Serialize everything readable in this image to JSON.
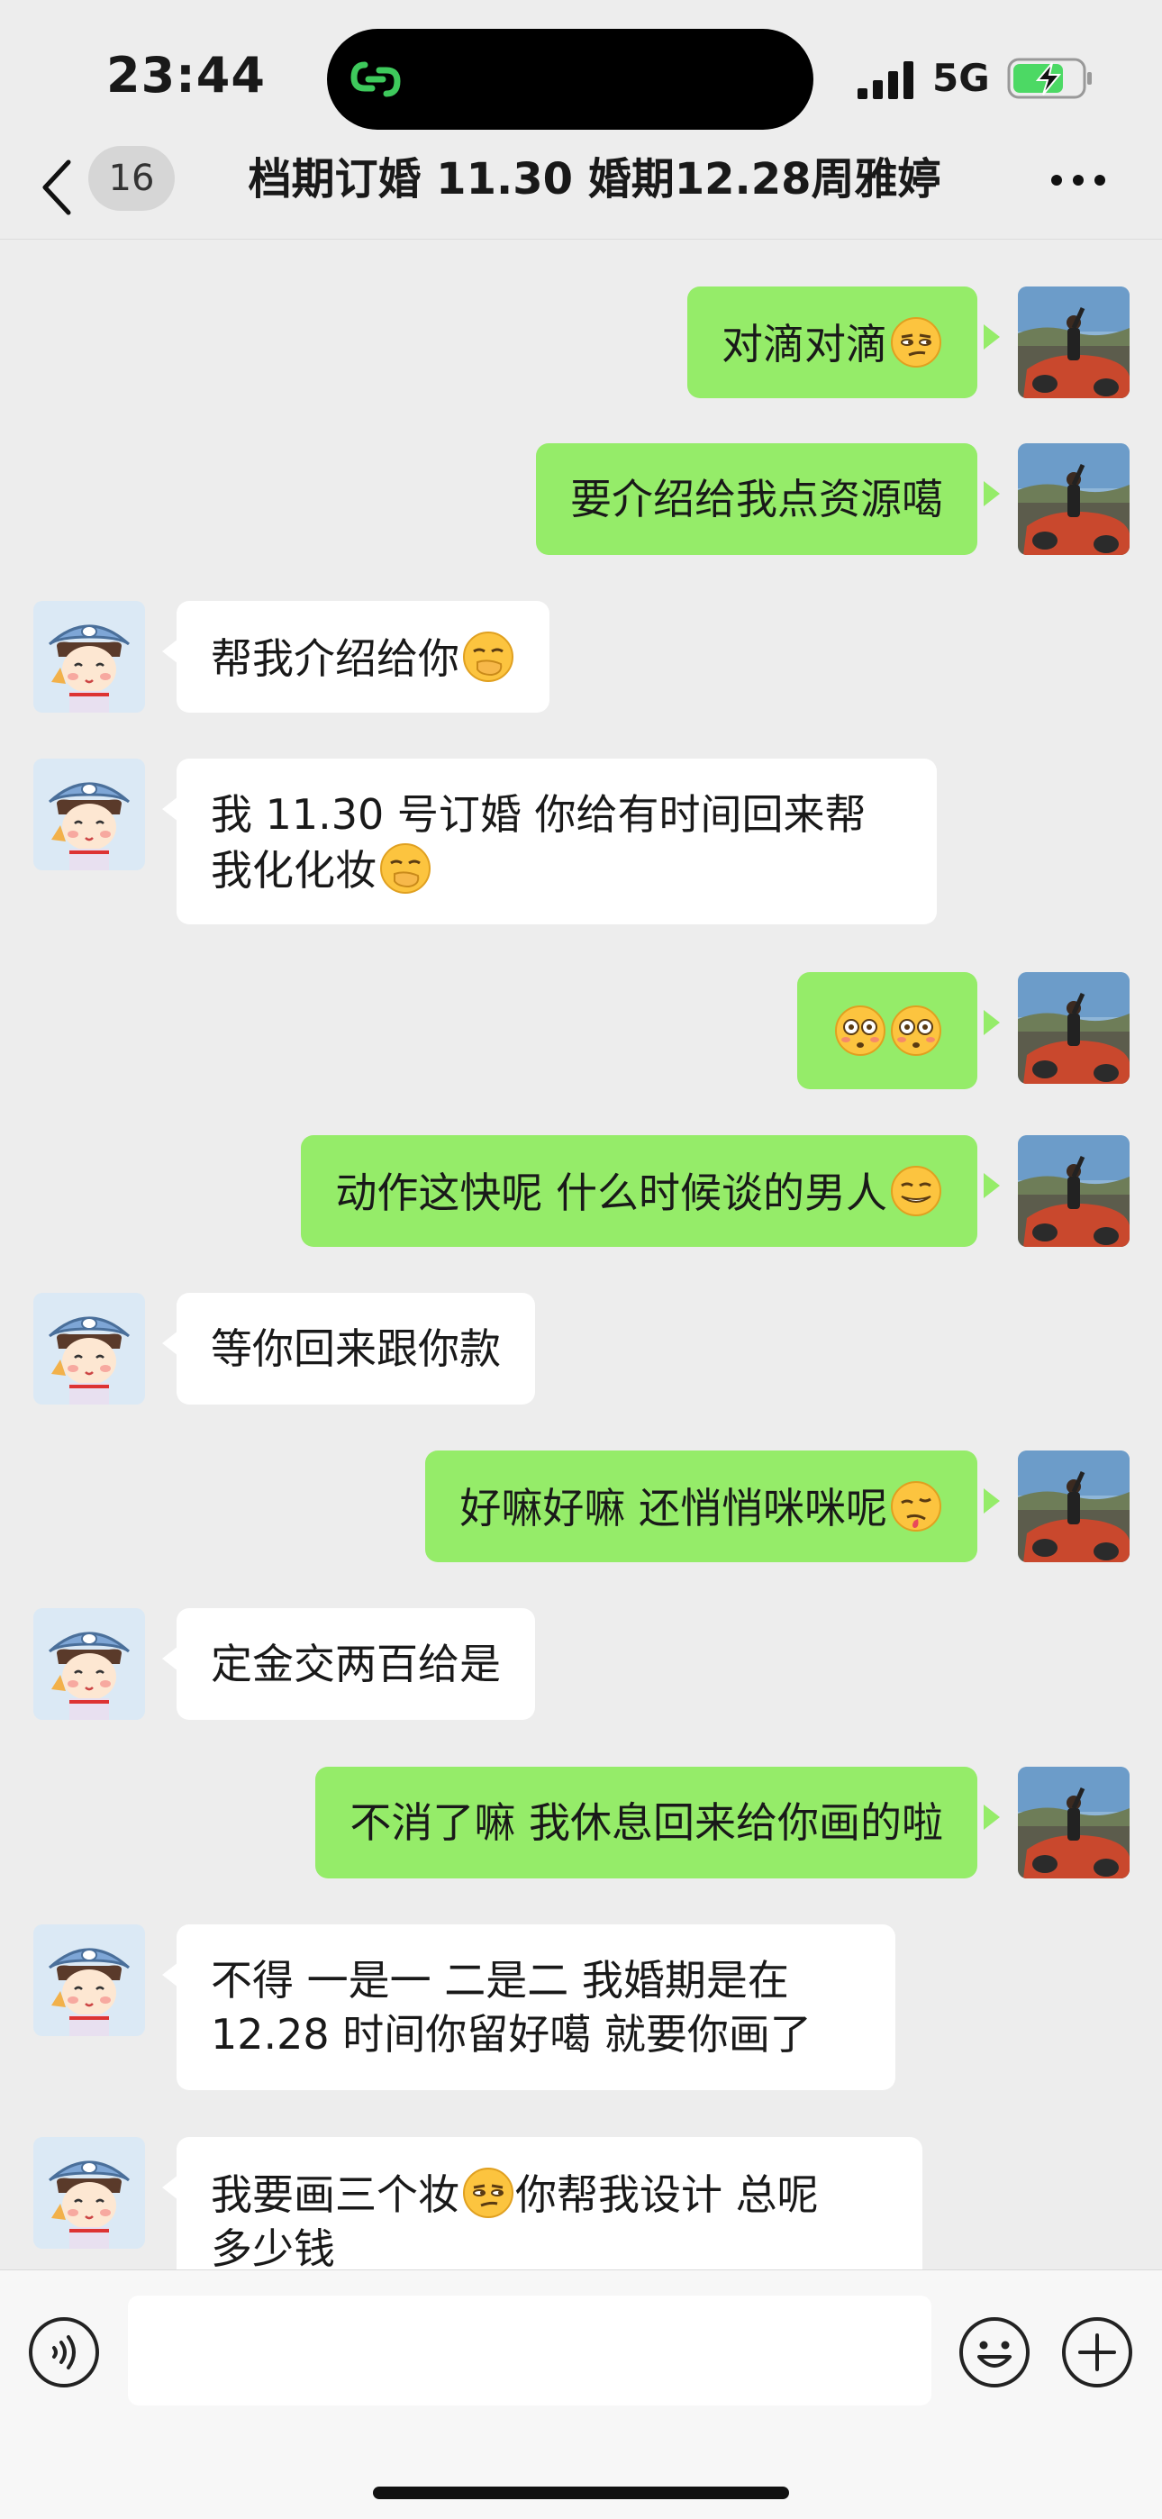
{
  "status_bar": {
    "time": "23:44",
    "network": "5G",
    "battery_charging": true
  },
  "nav": {
    "unread_count": "16",
    "title": "档期订婚 11.30 婚期12.28周雅婷"
  },
  "messages": [
    {
      "side": "out",
      "text": "对滴对滴",
      "emoji": "smirk-emoji"
    },
    {
      "side": "out",
      "text": "要介绍给我点资源噶"
    },
    {
      "side": "in",
      "text": "帮我介绍给你",
      "emoji": "hand-over-mouth-emoji"
    },
    {
      "side": "in",
      "line1": "我 11.30 号订婚  你给有时间回来帮",
      "line2": "我化化妆",
      "emoji": "hand-over-mouth-emoji"
    },
    {
      "side": "out",
      "emoji": "flushed-emoji",
      "emoji2": "flushed-emoji"
    },
    {
      "side": "out",
      "text": "动作这快呢  什么时候谈的男人",
      "emoji": "grimace-emoji"
    },
    {
      "side": "in",
      "text": "等你回来跟你款"
    },
    {
      "side": "out",
      "text": "好嘛好嘛 还悄悄咪咪呢",
      "emoji": "woozy-emoji"
    },
    {
      "side": "in",
      "text": "定金交两百给是"
    },
    {
      "side": "out",
      "text": "不消了嘛 我休息回来给你画的啦"
    },
    {
      "side": "in",
      "line1": "不得 一是一 二是二 我婚期是在",
      "line2": "12.28 时间你留好噶 就要你画了"
    },
    {
      "side": "in",
      "line1a": "我要画三个妆",
      "line1b": "你帮我设计  总呢",
      "line2": "多少钱",
      "emoji": "smirk-emoji"
    }
  ],
  "colors": {
    "outgoing_bubble": "#95ec69",
    "incoming_bubble": "#ffffff",
    "background": "#ededed"
  }
}
